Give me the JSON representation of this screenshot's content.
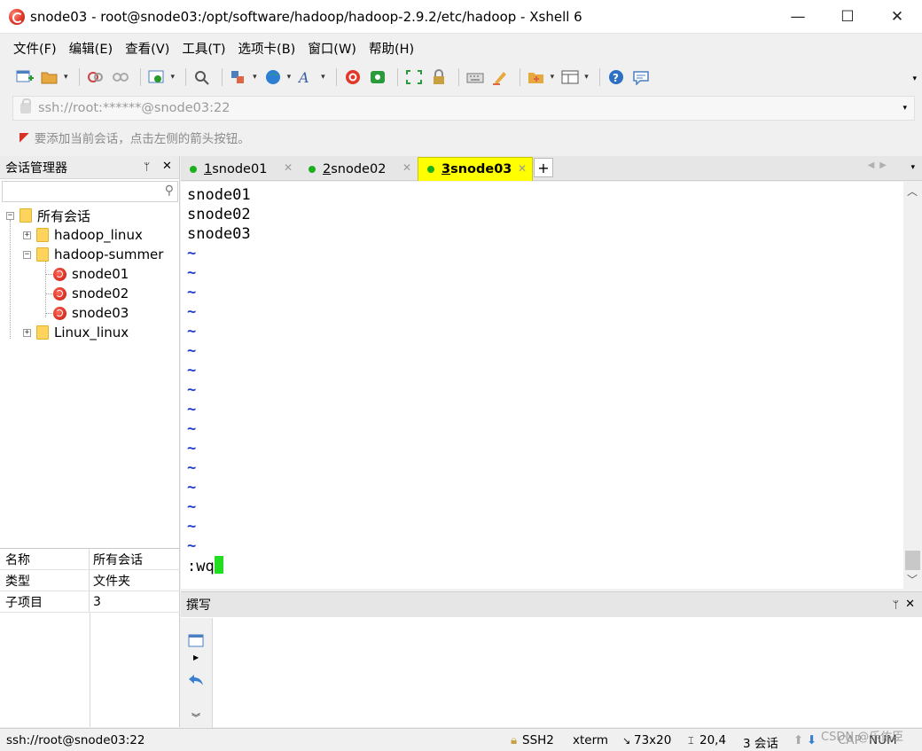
{
  "window": {
    "title": "snode03 - root@snode03:/opt/software/hadoop/hadoop-2.9.2/etc/hadoop - Xshell 6",
    "minimize": "—",
    "maximize": "☐",
    "close": "✕"
  },
  "menu": {
    "items": [
      "文件(F)",
      "编辑(E)",
      "查看(V)",
      "工具(T)",
      "选项卡(B)",
      "窗口(W)",
      "帮助(H)"
    ]
  },
  "toolbar": {
    "icons": [
      "new-session-icon",
      "open-folder-icon",
      "reconnect-icon",
      "disconnect-icon",
      "properties-icon",
      "find-icon",
      "transfer-icon",
      "globe-icon",
      "font-icon",
      "xshell-icon",
      "xftp-icon",
      "fullscreen-icon",
      "lock-icon",
      "keyboard-icon",
      "highlight-icon",
      "new-folder-icon",
      "layout-icon",
      "help-icon",
      "chat-icon"
    ]
  },
  "address": {
    "value": "ssh://root:******@snode03:22"
  },
  "hint": {
    "text": "要添加当前会话，点击左侧的箭头按钮。"
  },
  "session_manager": {
    "title": "会话管理器",
    "pin": "ᛘ",
    "close": "✕",
    "tree": {
      "root": "所有会话",
      "groups": [
        {
          "name": "hadoop_linux",
          "expander": "+"
        },
        {
          "name": "hadoop-summer",
          "expander": "−",
          "children": [
            "snode01",
            "snode02",
            "snode03"
          ]
        },
        {
          "name": "Linux_linux",
          "expander": "+"
        }
      ],
      "root_expander": "−"
    },
    "properties": [
      {
        "key": "名称",
        "value": "所有会话"
      },
      {
        "key": "类型",
        "value": "文件夹"
      },
      {
        "key": "子项目",
        "value": "3"
      }
    ]
  },
  "tabs": [
    {
      "number": "1",
      "name": " snode01",
      "active": false
    },
    {
      "number": "2",
      "name": " snode02",
      "active": false
    },
    {
      "number": "3",
      "name": " snode03",
      "active": true
    }
  ],
  "terminal": {
    "lines": [
      "snode01",
      "snode02",
      "snode03"
    ],
    "tilde": "~",
    "tilde_count": 16,
    "command": ":wq"
  },
  "compose": {
    "title": "撰写"
  },
  "status": {
    "connection": "ssh://root@snode03:22",
    "protocol": "SSH2",
    "terminal_type": "xterm",
    "size": "73x20",
    "cursor_pos": "20,4",
    "sessions": "3 会话",
    "caps": "CAP",
    "num": "NUM",
    "watermark": "CSDN @乐佑臣"
  },
  "colors": {
    "active_tab": "#ffff00",
    "tilde": "#1f3cc8",
    "cursor": "#22dd22",
    "session_dot": "#1db01d"
  }
}
